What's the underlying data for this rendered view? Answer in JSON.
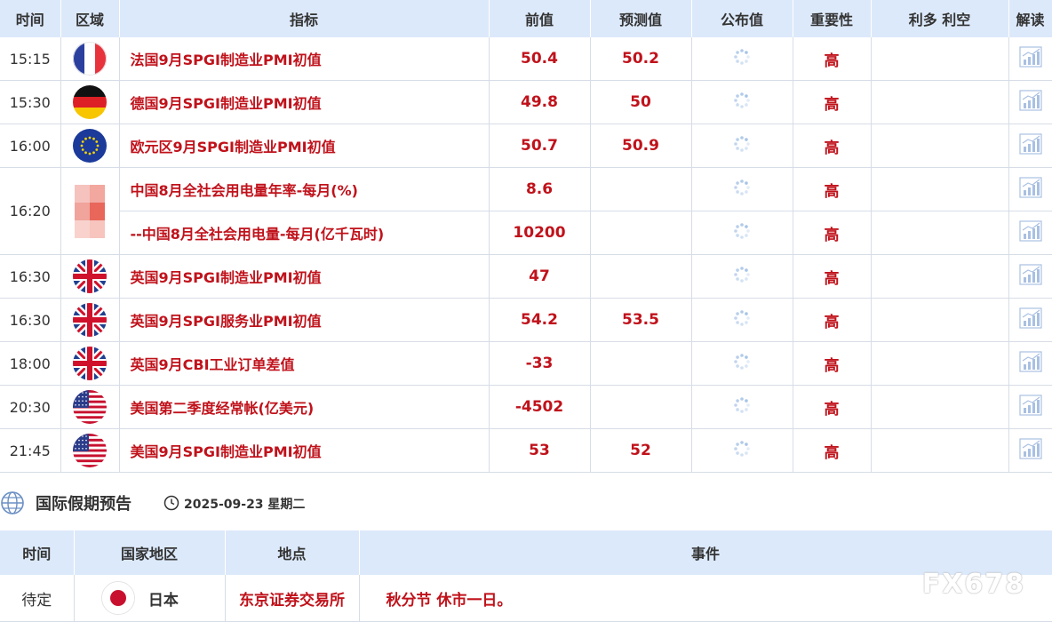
{
  "calendar": {
    "headers": {
      "time": "时间",
      "region": "区域",
      "indicator": "指标",
      "previous": "前值",
      "forecast": "预测值",
      "actual": "公布值",
      "importance": "重要性",
      "impact": "利多 利空",
      "analysis": "解读"
    },
    "rows": [
      {
        "time": "15:15",
        "flag": "france",
        "indicator": "法国9月SPGI制造业PMI初值",
        "previous": "50.4",
        "forecast": "50.2",
        "importance": "高"
      },
      {
        "time": "15:30",
        "flag": "germany",
        "indicator": "德国9月SPGI制造业PMI初值",
        "previous": "49.8",
        "forecast": "50",
        "importance": "高"
      },
      {
        "time": "16:00",
        "flag": "eu",
        "indicator": "欧元区9月SPGI制造业PMI初值",
        "previous": "50.7",
        "forecast": "50.9",
        "importance": "高"
      },
      {
        "time": "16:20",
        "flag": "china",
        "indicator": "中国8月全社会用电量年率-每月(%)",
        "previous": "8.6",
        "forecast": "",
        "importance": "高"
      },
      {
        "time": "",
        "flag": "",
        "indicator": "--中国8月全社会用电量-每月(亿千瓦时)",
        "previous": "10200",
        "forecast": "",
        "importance": "高"
      },
      {
        "time": "16:30",
        "flag": "uk",
        "indicator": "英国9月SPGI制造业PMI初值",
        "previous": "47",
        "forecast": "",
        "importance": "高"
      },
      {
        "time": "16:30",
        "flag": "uk",
        "indicator": "英国9月SPGI服务业PMI初值",
        "previous": "54.2",
        "forecast": "53.5",
        "importance": "高"
      },
      {
        "time": "18:00",
        "flag": "uk",
        "indicator": "英国9月CBI工业订单差值",
        "previous": "-33",
        "forecast": "",
        "importance": "高"
      },
      {
        "time": "20:30",
        "flag": "us",
        "indicator": "美国第二季度经常帐(亿美元)",
        "previous": "-4502",
        "forecast": "",
        "importance": "高"
      },
      {
        "time": "21:45",
        "flag": "us",
        "indicator": "美国9月SPGI制造业PMI初值",
        "previous": "53",
        "forecast": "52",
        "importance": "高"
      }
    ]
  },
  "holidays": {
    "section_title": "国际假期预告",
    "date": "2025-09-23 星期二",
    "headers": {
      "time": "时间",
      "country": "国家地区",
      "place": "地点",
      "event": "事件"
    },
    "rows": [
      {
        "time": "待定",
        "flag": "japan",
        "country": "日本",
        "place": "东京证券交易所",
        "event": "秋分节 休市一日。"
      }
    ]
  },
  "watermark": "FX678",
  "colors": {
    "accent_red": "#c0121b",
    "header_bg": "#dce9fa",
    "border": "#d7dde6"
  },
  "icons": {
    "actual_pending": "loading-spinner-icon",
    "analysis": "bar-chart-icon",
    "section": "globe-icon",
    "date": "clock-icon"
  }
}
